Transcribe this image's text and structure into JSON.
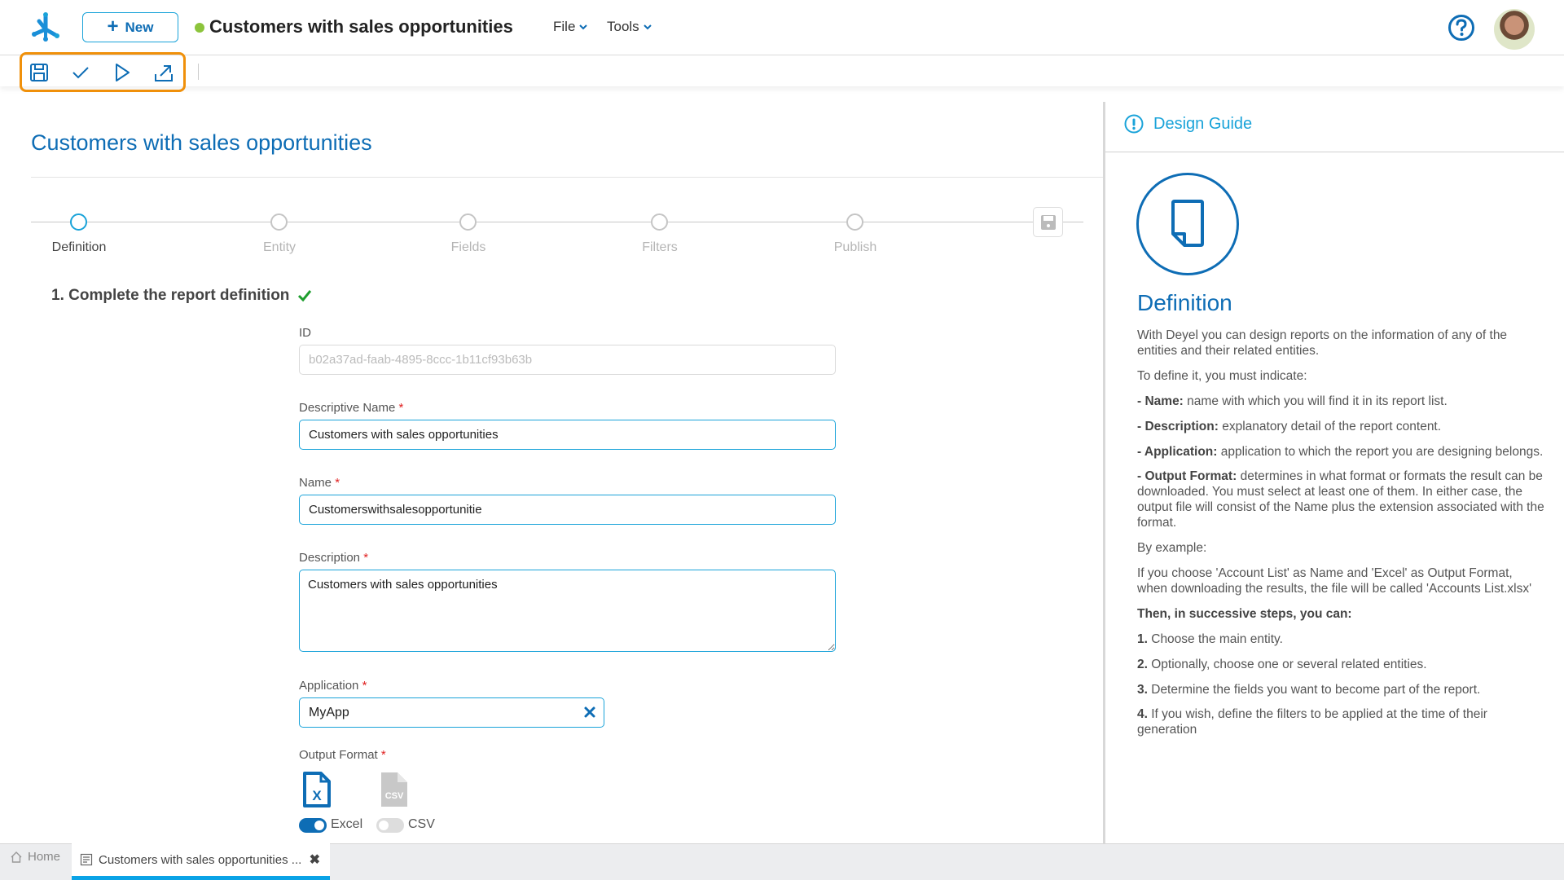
{
  "header": {
    "new_button": "New",
    "document_title": "Customers with sales opportunities",
    "status_color": "#8cc43c",
    "menus": [
      {
        "label": "File"
      },
      {
        "label": "Tools"
      }
    ],
    "help_icon": "help-circle-icon",
    "avatar": "user-avatar"
  },
  "toolbar": {
    "items": [
      {
        "icon": "save-icon"
      },
      {
        "icon": "check-icon"
      },
      {
        "icon": "play-icon"
      },
      {
        "icon": "export-icon"
      }
    ],
    "highlight_color": "#f0900a"
  },
  "main": {
    "title": "Customers with sales opportunities",
    "steps": [
      {
        "label": "Definition",
        "active": true
      },
      {
        "label": "Entity",
        "active": false
      },
      {
        "label": "Fields",
        "active": false
      },
      {
        "label": "Filters",
        "active": false
      },
      {
        "label": "Publish",
        "active": false
      }
    ],
    "section_heading": "1. Complete the report definition",
    "fields": {
      "id": {
        "label": "ID",
        "value": "b02a37ad-faab-4895-8ccc-1b11cf93b63b"
      },
      "descriptive_name": {
        "label": "Descriptive Name",
        "required": "*",
        "value": "Customers with sales opportunities"
      },
      "name": {
        "label": "Name",
        "required": "*",
        "value": "Customerswithsalesopportunitie"
      },
      "description": {
        "label": "Description",
        "required": "*",
        "value": "Customers with sales opportunities"
      },
      "application": {
        "label": "Application",
        "required": "*",
        "value": "MyApp"
      },
      "output_format": {
        "label": "Output Format",
        "required": "*",
        "options": [
          {
            "label": "Excel",
            "enabled": true,
            "icon": "excel-file-icon"
          },
          {
            "label": "CSV",
            "enabled": false,
            "icon": "csv-file-icon"
          }
        ]
      }
    }
  },
  "guide": {
    "header": "Design Guide",
    "title": "Definition",
    "intro": "With Deyel you can design reports on the information of any of the entities and their related entities.",
    "indicate": "To define it, you must indicate:",
    "items": [
      {
        "term": "- Name:",
        "text": " name with which you will find it in its report list."
      },
      {
        "term": "- Description:",
        "text": " explanatory detail of the report content."
      },
      {
        "term": "- Application:",
        "text": " application to which the report you are designing belongs."
      },
      {
        "term": "- Output Format:",
        "text": " determines in what format or formats the result can be downloaded. You must select at least one of them. In either case, the output file will consist of the Name plus the extension associated with the format."
      }
    ],
    "example_label": "By example:",
    "example_text": "If you choose 'Account List' as Name and 'Excel' as Output Format, when downloading the results, the file will be called 'Accounts List.xlsx'",
    "steps_heading": "Then, in successive steps, you can:",
    "steps": [
      {
        "num": "1.",
        "text": " Choose the main entity."
      },
      {
        "num": "2.",
        "text": " Optionally, choose one or several related entities."
      },
      {
        "num": "3.",
        "text": " Determine the fields you want to become part of the report."
      },
      {
        "num": "4.",
        "text": " If you wish, define the filters to be applied at the time of their generation"
      }
    ]
  },
  "bottom_tabs": {
    "home": "Home",
    "current": "Customers with sales opportunities ...",
    "accent": "#0aa3e6"
  }
}
